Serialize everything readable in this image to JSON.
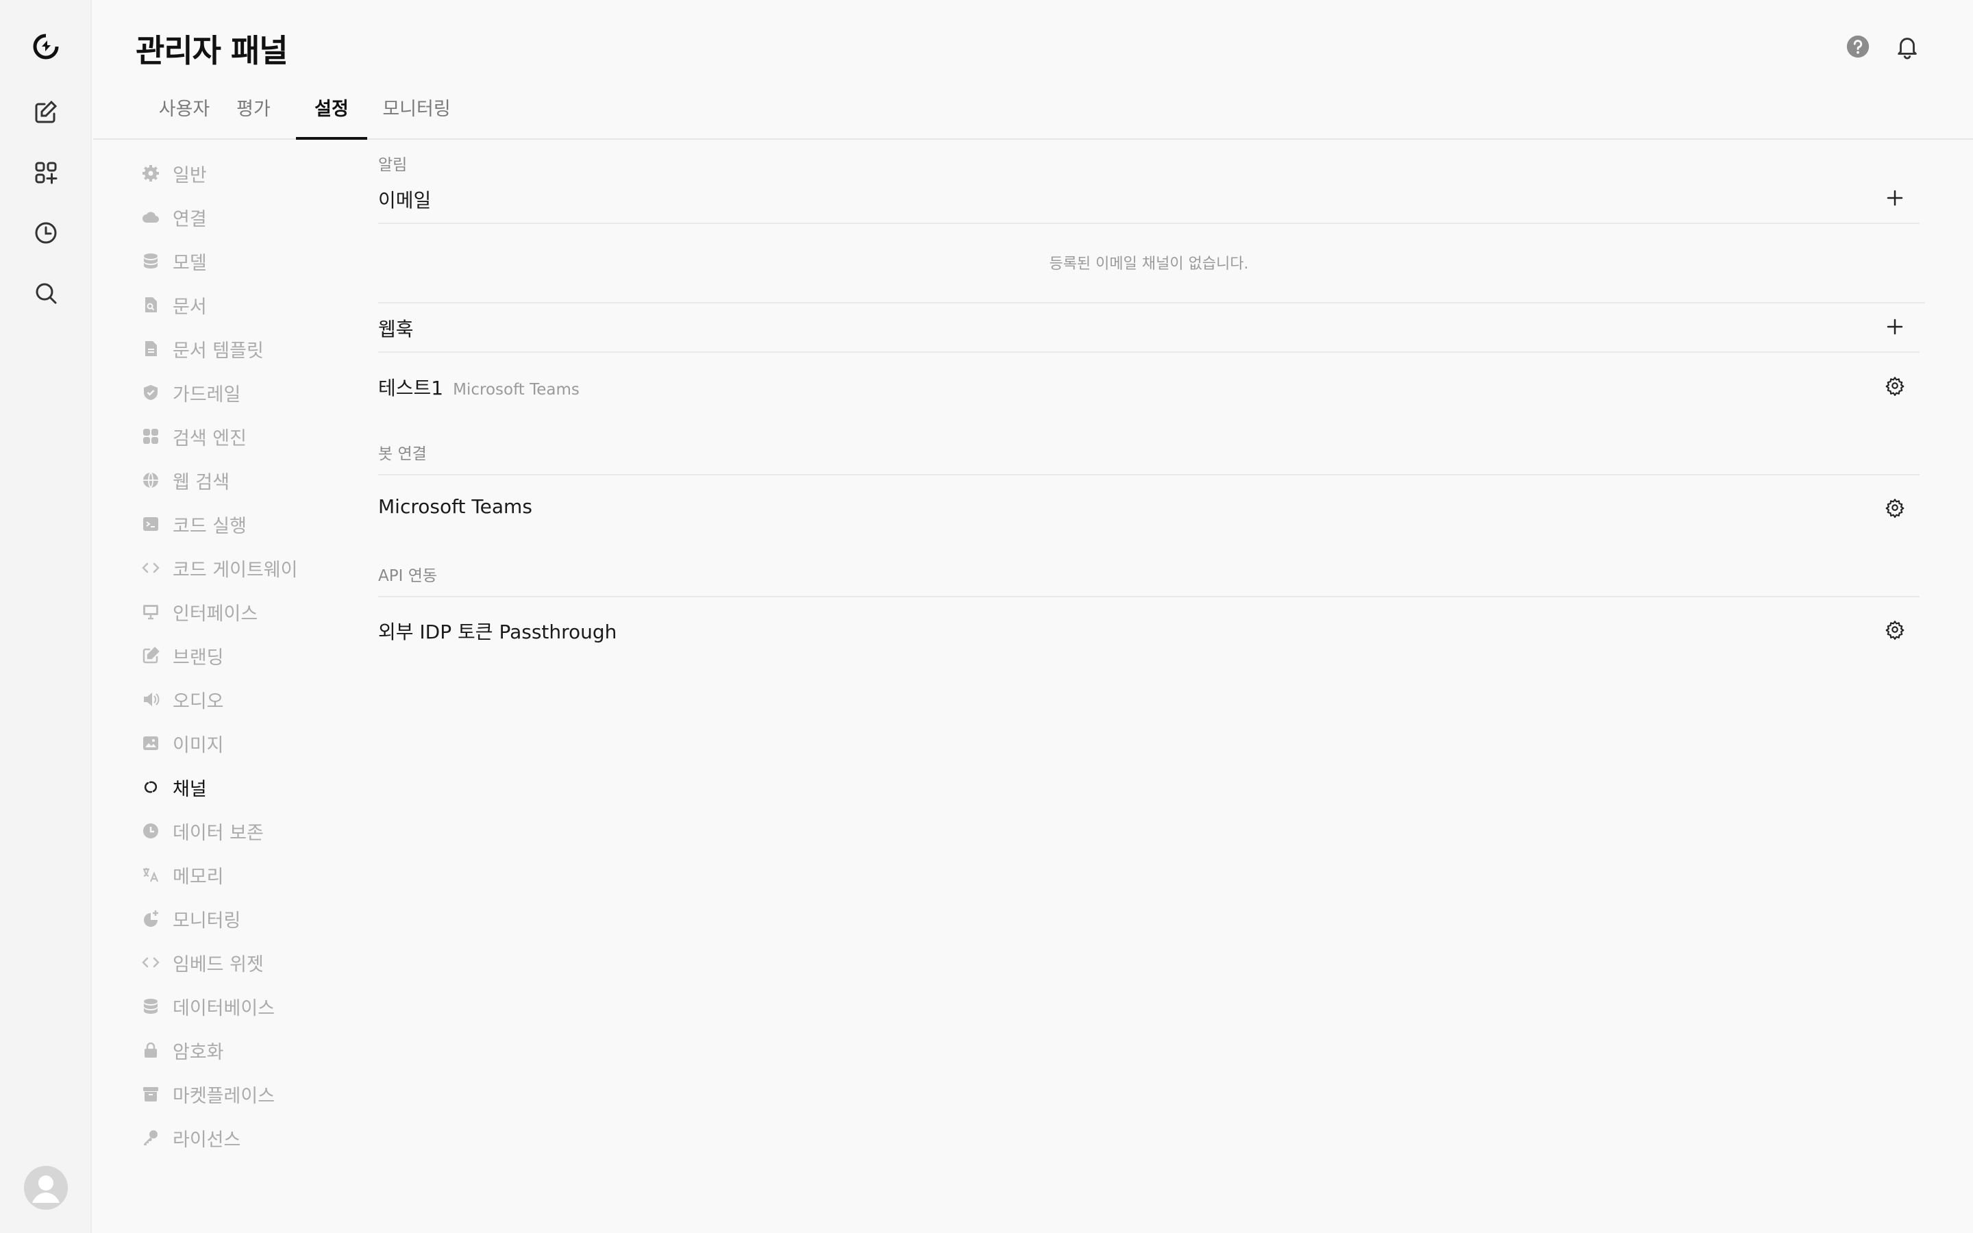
{
  "header": {
    "title": "관리자 패널"
  },
  "tabs": [
    {
      "label": "사용자",
      "active": false
    },
    {
      "label": "평가",
      "active": false
    },
    {
      "label": "설정",
      "active": true
    },
    {
      "label": "모니터링",
      "active": false
    }
  ],
  "sidebar": {
    "items": [
      {
        "label": "일반",
        "icon": "gear-icon"
      },
      {
        "label": "연결",
        "icon": "cloud-icon"
      },
      {
        "label": "모델",
        "icon": "database-icon"
      },
      {
        "label": "문서",
        "icon": "document-search-icon"
      },
      {
        "label": "문서 템플릿",
        "icon": "document-icon"
      },
      {
        "label": "가드레일",
        "icon": "shield-icon"
      },
      {
        "label": "검색 엔진",
        "icon": "grid-icon"
      },
      {
        "label": "웹 검색",
        "icon": "globe-icon"
      },
      {
        "label": "코드 실행",
        "icon": "terminal-icon"
      },
      {
        "label": "코드 게이트웨이",
        "icon": "code-icon"
      },
      {
        "label": "인터페이스",
        "icon": "monitor-icon"
      },
      {
        "label": "브랜딩",
        "icon": "pencil-square-icon"
      },
      {
        "label": "오디오",
        "icon": "speaker-icon"
      },
      {
        "label": "이미지",
        "icon": "image-icon"
      },
      {
        "label": "채널",
        "icon": "link-icon",
        "active": true
      },
      {
        "label": "데이터 보존",
        "icon": "clock-icon"
      },
      {
        "label": "메모리",
        "icon": "language-icon"
      },
      {
        "label": "모니터링",
        "icon": "chart-plus-icon"
      },
      {
        "label": "임베드 위젯",
        "icon": "code-icon"
      },
      {
        "label": "데이터베이스",
        "icon": "database-icon"
      },
      {
        "label": "암호화",
        "icon": "lock-icon"
      },
      {
        "label": "마켓플레이스",
        "icon": "archive-icon"
      },
      {
        "label": "라이선스",
        "icon": "key-icon"
      }
    ]
  },
  "content": {
    "notifications": {
      "label": "알림",
      "email": {
        "title": "이메일",
        "empty": "등록된 이메일 채널이 없습니다."
      },
      "webhook": {
        "title": "웹훅",
        "items": [
          {
            "name": "테스트1",
            "type": "Microsoft Teams"
          }
        ]
      }
    },
    "bot": {
      "label": "봇 연결",
      "items": [
        {
          "name": "Microsoft Teams"
        }
      ]
    },
    "api": {
      "label": "API 연동",
      "items": [
        {
          "name": "외부 IDP 토큰 Passthrough"
        }
      ]
    }
  }
}
